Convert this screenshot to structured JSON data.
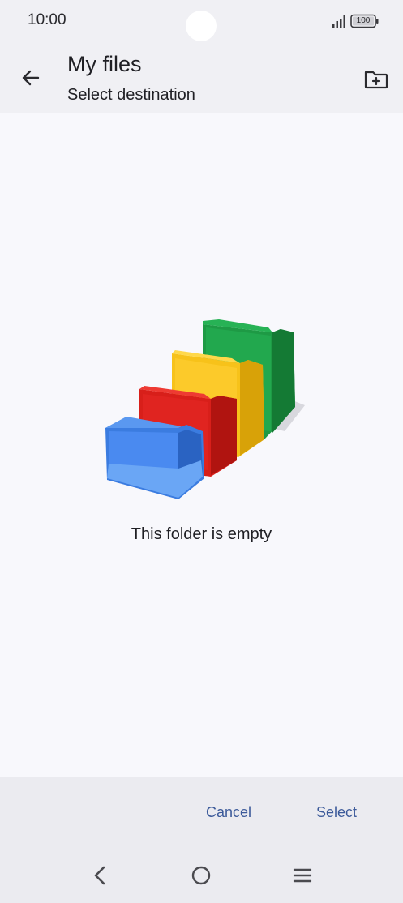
{
  "status_bar": {
    "time": "10:00",
    "battery": "100",
    "icons": [
      "signal-icon",
      "battery-icon"
    ]
  },
  "app_bar": {
    "title": "My files",
    "subtitle": "Select destination",
    "icons": [
      "arrow-left-icon",
      "new-folder-icon"
    ]
  },
  "empty_state": {
    "message": "This folder is empty",
    "illustration": "colorful-folders-illustration"
  },
  "actions": {
    "cancel_label": "Cancel",
    "select_label": "Select",
    "accent_color": "#3c5a9a"
  },
  "nav_bar": {
    "icons": [
      "nav-back-icon",
      "nav-home-icon",
      "nav-recents-icon"
    ]
  },
  "colors": {
    "header_bg": "#f0f0f4",
    "content_bg": "#f8f8fc",
    "action_bar_bg": "#ebebf0",
    "folder_blue": "#3b7ce0",
    "folder_red": "#d81f1a",
    "folder_yellow": "#f7c21a",
    "folder_green": "#1e9a45"
  }
}
